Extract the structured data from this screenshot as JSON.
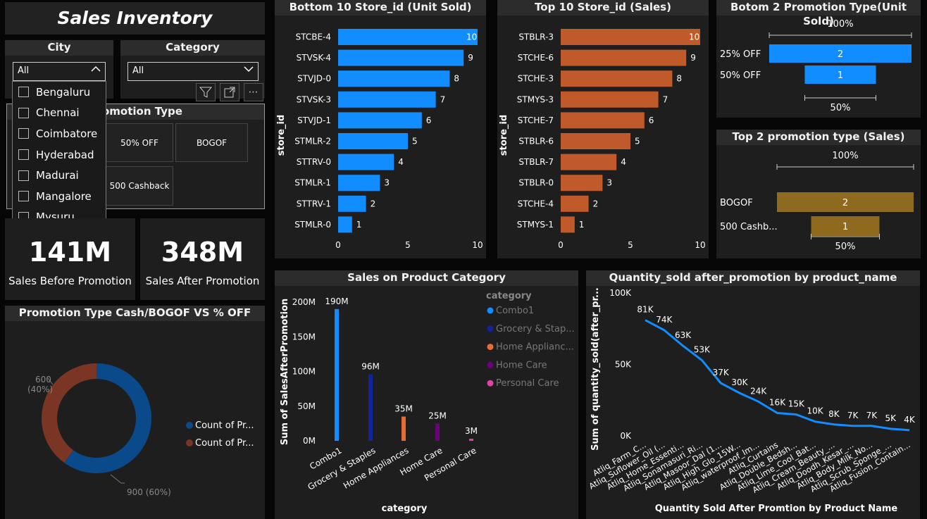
{
  "title": "Sales Inventory",
  "city_slicer": {
    "title": "City",
    "selected": "All",
    "options": [
      "Bengaluru",
      "Chennai",
      "Coimbatore",
      "Hyderabad",
      "Madurai",
      "Mangalore",
      "Mysuru"
    ]
  },
  "category_slicer": {
    "title": "Category",
    "selected": "All"
  },
  "promo_slicer": {
    "title": "Promotion Type",
    "visible_title": "omotion Type",
    "buttons": [
      "50% OFF",
      "BOGOF",
      "500 Cashback"
    ]
  },
  "kpis": [
    {
      "value": "141M",
      "label": "Sales Before Promotion"
    },
    {
      "value": "348M",
      "label": "Sales After Promotion"
    }
  ],
  "colors": {
    "blue": "#118DFF",
    "orange": "#C05A2A",
    "gold": "#8F6A1E",
    "navy": "#12239E",
    "homeapp": "#E66C37",
    "homecare": "#6B007B",
    "personal": "#E044A7",
    "donut_blue": "#0B4A8A",
    "donut_brown": "#7A3524"
  },
  "chart_data": [
    {
      "type": "bar",
      "title": "Bottom 10 Store_id (Unit Sold)",
      "ylabel": "store_id",
      "categories": [
        "STCBE-4",
        "STVSK-4",
        "STVJD-0",
        "STVSK-3",
        "STVJD-1",
        "STMLR-2",
        "STTRV-0",
        "STMLR-1",
        "STTRV-1",
        "STMLR-0"
      ],
      "values": [
        10,
        9,
        8,
        7,
        6,
        5,
        4,
        3,
        2,
        1
      ],
      "xticks": [
        "0",
        "5",
        "10"
      ],
      "xlim": [
        0,
        10
      ]
    },
    {
      "type": "bar",
      "title": "Top 10 Store_id (Sales)",
      "ylabel": "store_id",
      "categories": [
        "STBLR-3",
        "STCHE-6",
        "STCHE-3",
        "STMYS-3",
        "STCHE-7",
        "STBLR-6",
        "STBLR-7",
        "STBLR-0",
        "STCHE-4",
        "STMYS-1"
      ],
      "values": [
        10,
        9,
        8,
        7,
        6,
        5,
        4,
        3,
        2,
        1
      ],
      "xticks": [
        "0",
        "5",
        "10"
      ],
      "xlim": [
        0,
        10
      ]
    },
    {
      "type": "bar",
      "title": "Botom 2 Promotion Type(Unit Sold)",
      "categories": [
        "25% OFF",
        "50% OFF"
      ],
      "values": [
        2,
        1
      ],
      "top_label": "100%",
      "bottom_label": "50%"
    },
    {
      "type": "bar",
      "title": "Top 2 promotion type (Sales)",
      "categories": [
        "BOGOF",
        "500 Cashb..."
      ],
      "values": [
        2,
        1
      ],
      "top_label": "100%",
      "bottom_label": "50%"
    },
    {
      "type": "bar",
      "title": "Sales on Product Category",
      "xlabel": "category",
      "ylabel": "Sum of SalesAfterPromotion",
      "categories": [
        "Combo1",
        "Grocery & Staples",
        "Home Appliances",
        "Home Care",
        "Personal Care"
      ],
      "values": [
        190,
        96,
        35,
        25,
        3
      ],
      "labels": [
        "190M",
        "96M",
        "35M",
        "25M",
        "3M"
      ],
      "yticks": [
        "0M",
        "50M",
        "100M",
        "150M",
        "200M"
      ],
      "ylim": [
        0,
        200
      ],
      "legend_title": "category",
      "legend": [
        "Combo1",
        "Grocery & Stap...",
        "Home Applianc...",
        "Home Care",
        "Personal Care"
      ]
    },
    {
      "type": "line",
      "title": "Quantity_sold after_promotion by product_name",
      "xlabel": "Quantity Sold After Promtion by Product Name",
      "ylabel": "Sum of quantity_sold(after_pr...",
      "categories": [
        "Atliq_Farm_C...",
        "Atliq_Suflower_Oil (...",
        "Atliq_Home_Essenti...",
        "Atliq_Sonamasuri_Ri...",
        "Atliq_Masoor_Dal (1...",
        "Atliq_High_Glo_15W...",
        "Atliq_waterproof_Im...",
        "Atliq_Curtains",
        "Atliq_Double_Bedsh...",
        "Atliq_Lime_Cool_Bat...",
        "Atliq_Cream_Beauty_...",
        "Atliq_Doodh_Kesar_...",
        "Atliq_Body_Milk_No...",
        "Atliq_Scrub_Sponge_...",
        "Atliq_Fusion_Contain..."
      ],
      "values": [
        81,
        74,
        63,
        53,
        37,
        30,
        24,
        16,
        15,
        10,
        8,
        7,
        7,
        5,
        4
      ],
      "labels": [
        "81K",
        "74K",
        "63K",
        "53K",
        "37K",
        "30K",
        "24K",
        "16K",
        "15K",
        "10K",
        "8K",
        "7K",
        "7K",
        "5K",
        "4K"
      ],
      "yticks": [
        "0K",
        "50K",
        "100K"
      ],
      "ylim": [
        0,
        100
      ]
    },
    {
      "type": "pie",
      "title": "Promotion Type Cash/BOGOF VS % OFF",
      "slices": [
        {
          "value": 900,
          "label": "900 (60%)"
        },
        {
          "value": 600,
          "label": "600\n(40%)",
          "line1": "600",
          "line2": "(40%)"
        }
      ],
      "legend": [
        "Count of Pr...",
        "Count of Pr..."
      ]
    }
  ]
}
